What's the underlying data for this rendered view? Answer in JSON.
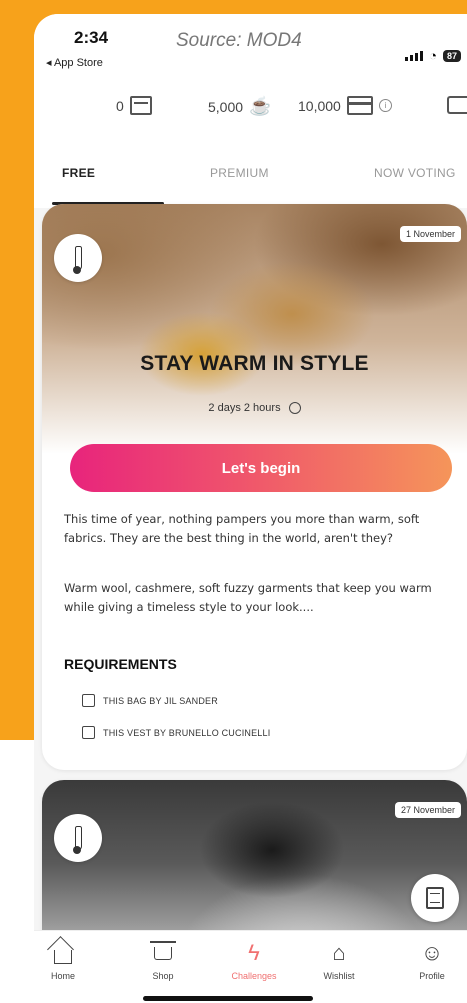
{
  "status_bar": {
    "time": "2:34",
    "back_label": "◂ App Store",
    "source_label": "Source: MOD4",
    "battery": "87"
  },
  "currency": {
    "boxes": "0",
    "trophies": "5,000",
    "cards": "10,000"
  },
  "tabs": [
    {
      "label": "FREE",
      "active": true
    },
    {
      "label": "PREMIUM",
      "active": false
    },
    {
      "label": "NOW VOTING",
      "active": false
    }
  ],
  "challenges": [
    {
      "date": "1 November",
      "title": "STAY WARM IN STYLE",
      "duration": "2 days 2 hours",
      "cta": "Let's begin",
      "description_1": "This time of year, nothing pampers you more than warm, soft fabrics. They are the best thing in the world, aren't they?",
      "description_2": "Warm wool, cashmere, soft fuzzy garments that keep you warm while giving a timeless style to your look....",
      "requirements_title": "REQUIREMENTS",
      "requirements": [
        "THIS BAG BY JIL SANDER",
        "THIS VEST BY BRUNELLO CUCINELLI"
      ]
    },
    {
      "date": "27 November"
    }
  ],
  "bottom_nav": [
    {
      "label": "Home",
      "icon": "home-icon"
    },
    {
      "label": "Shop",
      "icon": "cart-icon"
    },
    {
      "label": "Challenges",
      "icon": "lightning-icon",
      "active": true
    },
    {
      "label": "Wishlist",
      "icon": "hanger-icon"
    },
    {
      "label": "Profile",
      "icon": "profile-icon"
    }
  ],
  "colors": {
    "background_orange": "#f7a21b",
    "cta_gradient_start": "#e8247c",
    "cta_gradient_end": "#f5955a",
    "active_nav": "#f07070"
  }
}
